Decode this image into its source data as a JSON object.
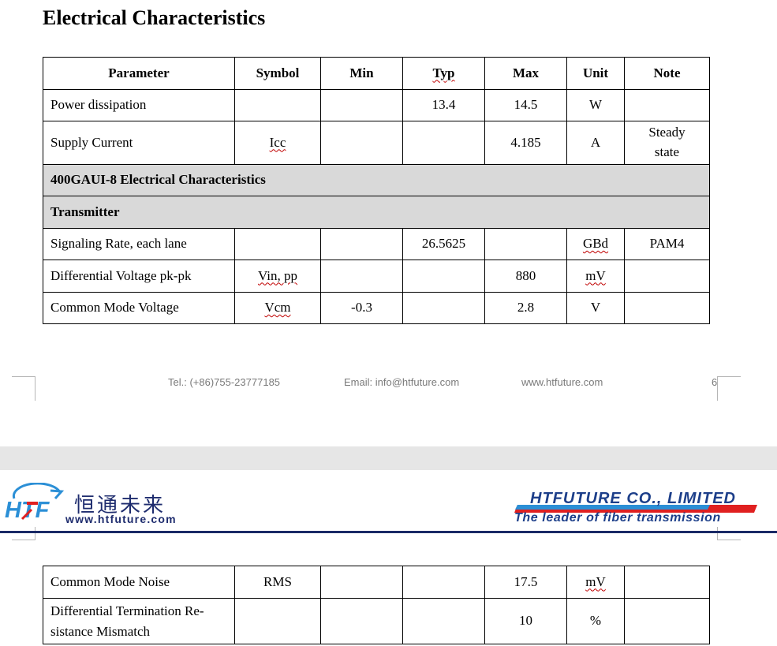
{
  "page1": {
    "heading": "Electrical Characteristics",
    "table": {
      "headers": [
        "Parameter",
        "Symbol",
        "Min",
        "Typ",
        "Max",
        "Unit",
        "Note"
      ],
      "rows": [
        [
          "Power dissipation",
          "",
          "",
          "13.4",
          "14.5",
          "W",
          ""
        ],
        [
          "Supply Current",
          "Icc",
          "",
          "",
          "4.185",
          "A",
          "Steady state"
        ]
      ],
      "section1": "400GAUI-8 Electrical Characteristics",
      "section2": "Transmitter",
      "rows2": [
        [
          "Signaling Rate, each lane",
          "",
          "",
          "26.5625",
          "",
          "GBd",
          "PAM4"
        ],
        [
          "Differential Voltage pk-pk",
          "Vin, pp",
          "",
          "",
          "880",
          "mV",
          ""
        ],
        [
          "Common Mode Voltage",
          "Vcm",
          "-0.3",
          "",
          "2.8",
          "V",
          ""
        ]
      ]
    },
    "footer": {
      "tel": "Tel.: (+86)755-23777185",
      "email": "Email: info@htfuture.com",
      "web": "www.htfuture.com",
      "page_number": "6"
    }
  },
  "page2": {
    "logo": {
      "mark": "HTF",
      "chinese_name": "恒通未来",
      "url": "www.htfuture.com"
    },
    "company": "HTFUTURE CO., LIMITED",
    "tagline": "The leader of fiber transmission",
    "table": {
      "rows": [
        [
          "Common Mode Noise",
          "RMS",
          "",
          "",
          "17.5",
          "mV",
          ""
        ],
        [
          "Differential Termination Re-sistance Mismatch",
          "",
          "",
          "",
          "10",
          "%",
          ""
        ]
      ]
    }
  },
  "colors": {
    "section_bg": "#d9d9d9",
    "spell_underline": "#c00000",
    "brand_navy": "#1d3f8a",
    "logo_blue": "#2b8fd6",
    "logo_red": "#e02020",
    "page_gap": "#e6e6e6"
  }
}
